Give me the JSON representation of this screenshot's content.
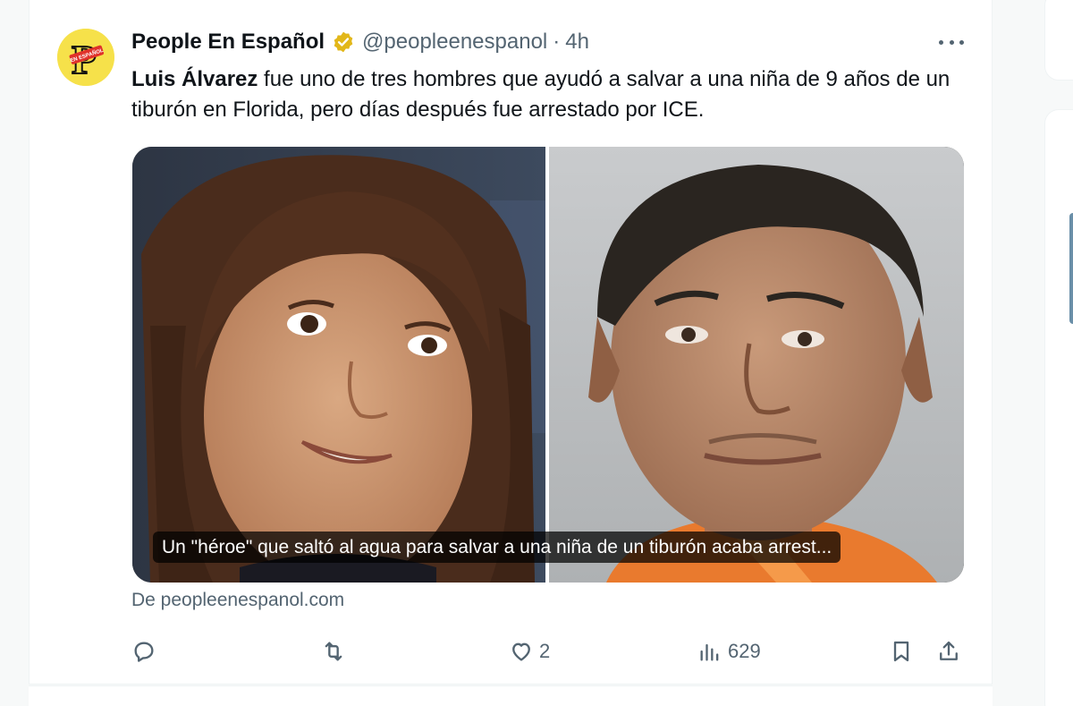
{
  "tweet": {
    "display_name": "People En Español",
    "handle": "@peopleenespanol",
    "separator": "·",
    "time": "4h",
    "text_bold": "Luis Álvarez",
    "text_rest": " fue uno de tres hombres que ayudó a salvar a una niña de 9 años de un tiburón en Florida, pero días después fue arrestado por ICE.",
    "card_caption": "Un \"héroe\" que saltó al agua para salvar a una niña de un tiburón acaba arrest...",
    "source": "De peopleenespanol.com",
    "avatar_logo_text": "P",
    "avatar_badge_text": "EN ESPAÑOL"
  },
  "actions": {
    "reply_icon": "reply-icon",
    "retweet_icon": "retweet-icon",
    "like_icon": "heart-icon",
    "like_count": "2",
    "views_icon": "views-icon",
    "view_count": "629",
    "bookmark_icon": "bookmark-icon",
    "share_icon": "share-icon"
  },
  "colors": {
    "text": "#0f1419",
    "secondary_text": "#536471",
    "verified_gold": "#e2b719",
    "avatar_bg": "#f6e14a",
    "logo_red": "#e0322a",
    "background": "#f7f9f9"
  }
}
